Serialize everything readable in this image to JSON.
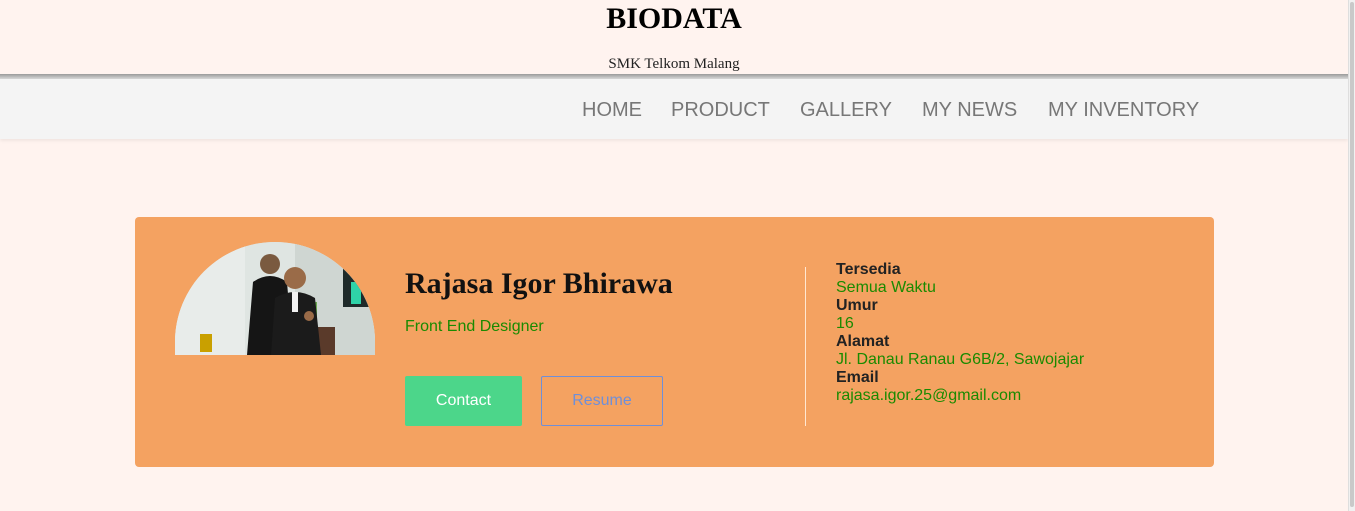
{
  "header": {
    "title": "BIODATA",
    "subtitle": "SMK Telkom Malang"
  },
  "nav": {
    "items": [
      "HOME",
      "PRODUCT",
      "GALLERY",
      "MY NEWS",
      "MY INVENTORY"
    ]
  },
  "profile": {
    "name": "Rajasa Igor Bhirawa",
    "role": "Front End Designer",
    "contact_label": "Contact",
    "resume_label": "Resume",
    "details": [
      {
        "label": "Tersedia",
        "value": "Semua Waktu"
      },
      {
        "label": "Umur",
        "value": "16"
      },
      {
        "label": "Alamat",
        "value": "Jl. Danau Ranau G6B/2, Sawojajar"
      },
      {
        "label": "Email",
        "value": "rajasa.igor.25@gmail.com"
      }
    ]
  },
  "colors": {
    "page_bg": "#fff3ef",
    "card_bg": "#f4a261",
    "accent_green": "#1a8a00",
    "contact_button": "#4cd68a",
    "resume_border": "#6f8fd8"
  }
}
